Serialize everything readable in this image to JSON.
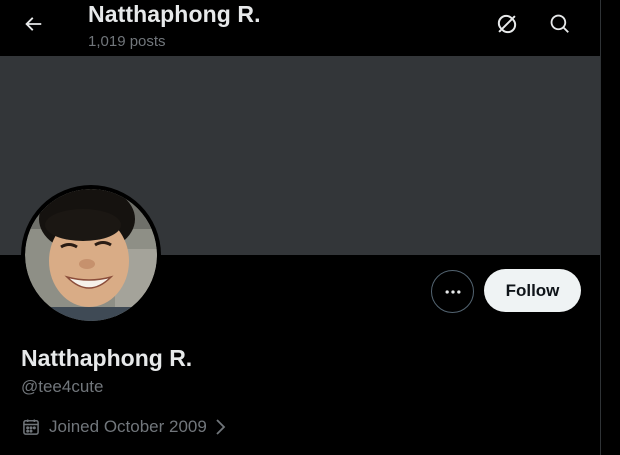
{
  "header": {
    "title": "Natthaphong R.",
    "post_count": "1,019 posts"
  },
  "profile": {
    "display_name": "Natthaphong R.",
    "handle": "@tee4cute",
    "joined": "Joined October 2009"
  },
  "actions": {
    "follow_label": "Follow"
  },
  "icons": {
    "back": "arrow-left-icon",
    "grok": "grok-icon",
    "search": "search-icon",
    "more": "more-horizontal-icon",
    "calendar": "calendar-icon",
    "chevron": "chevron-right-icon"
  },
  "colors": {
    "background": "#000000",
    "banner": "#333639",
    "text_primary": "#e7e9ea",
    "text_secondary": "#71767b",
    "follow_bg": "#eff3f4",
    "follow_text": "#0f1419",
    "border": "#536471"
  }
}
